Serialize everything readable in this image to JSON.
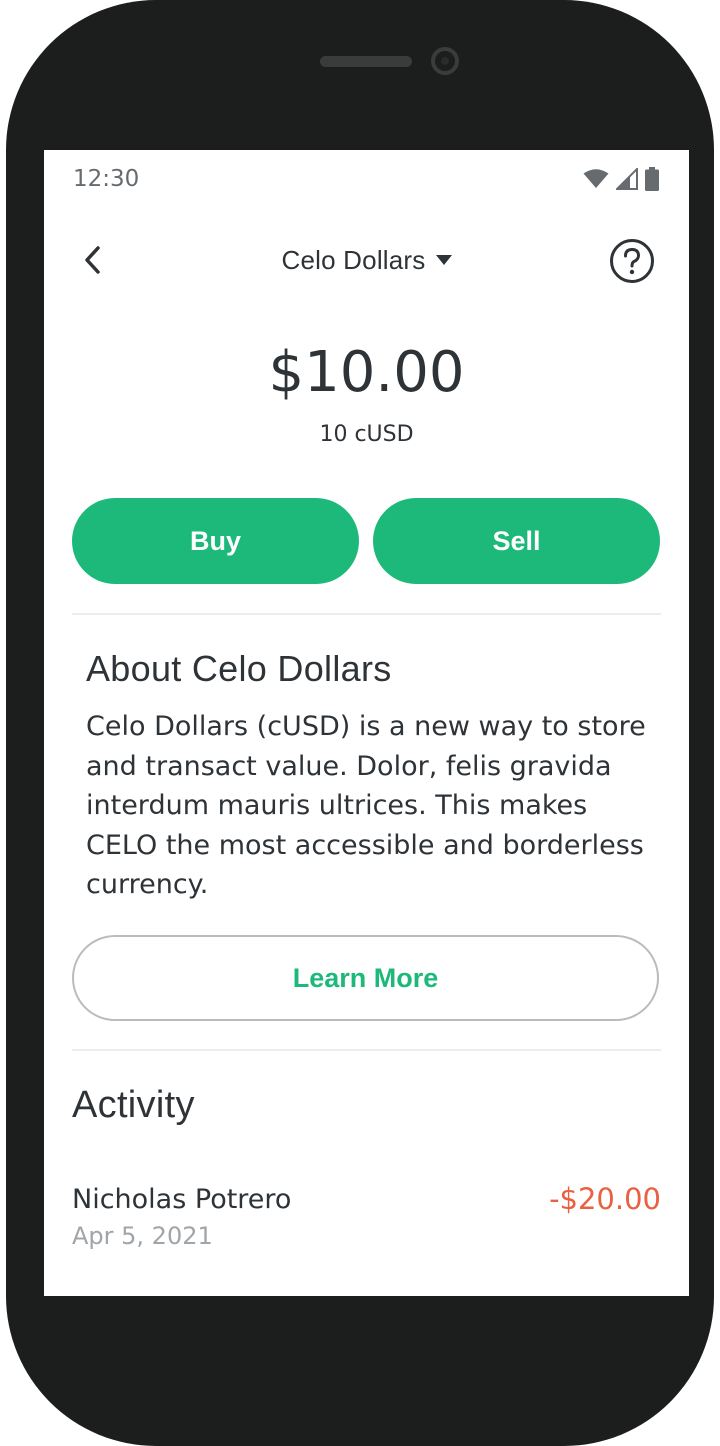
{
  "status_bar": {
    "time": "12:30",
    "icons": [
      "wifi-icon",
      "cellular-signal-icon",
      "battery-icon"
    ]
  },
  "header": {
    "title": "Celo Dollars",
    "dropdown_icon": "caret-down-icon",
    "back_icon": "chevron-left-icon",
    "help_icon": "help-circle-icon"
  },
  "balance": {
    "amount": "$10.00",
    "token_amount": "10 cUSD"
  },
  "actions": {
    "buy_label": "Buy",
    "sell_label": "Sell"
  },
  "about": {
    "title": "About Celo Dollars",
    "body": "Celo Dollars (cUSD) is a new way to store and transact value.  Dolor, felis gravida interdum mauris ultrices. This makes CELO the most accessible and borderless currency.",
    "learn_more_label": "Learn More"
  },
  "activity": {
    "title": "Activity",
    "items": [
      {
        "name": "Nicholas Potrero",
        "date": "Apr 5, 2021",
        "amount": "-$20.00"
      }
    ]
  },
  "colors": {
    "accent_green": "#1db97a",
    "negative_red": "#ea6042",
    "text_primary": "#2e3338",
    "text_secondary": "#a0a5aa",
    "device_frame": "#1c1d1d"
  }
}
